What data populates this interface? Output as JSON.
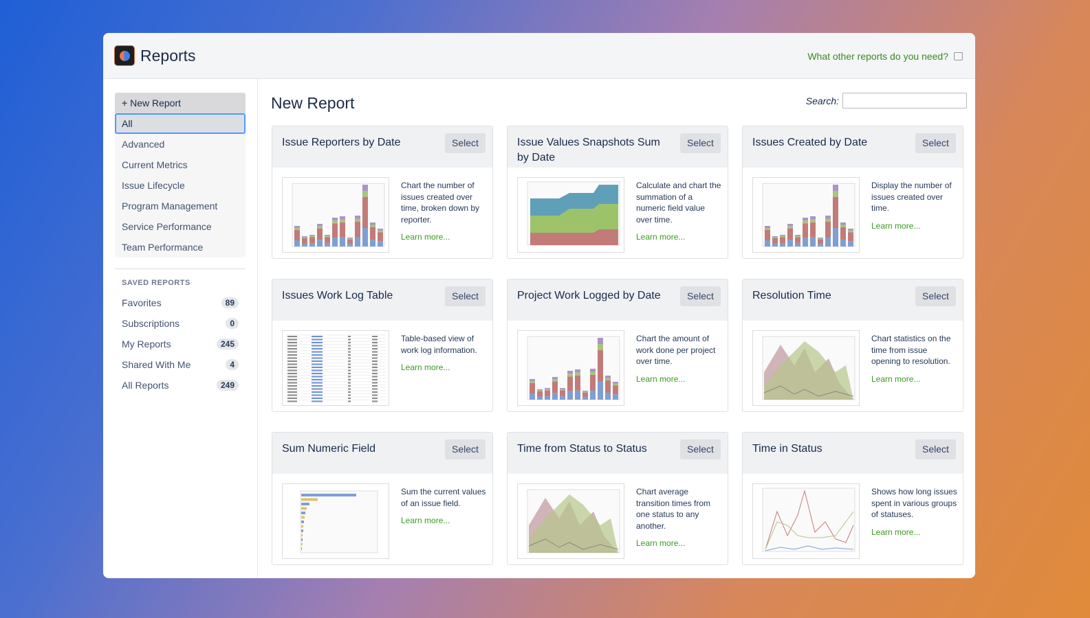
{
  "app": {
    "title": "Reports",
    "feedback": "What other reports do you need?"
  },
  "sidebar": {
    "new_report": "New Report",
    "categories": [
      "All",
      "Advanced",
      "Current Metrics",
      "Issue Lifecycle",
      "Program Management",
      "Service Performance",
      "Team Performance"
    ],
    "saved_heading": "SAVED REPORTS",
    "saved": [
      {
        "label": "Favorites",
        "count": "89"
      },
      {
        "label": "Subscriptions",
        "count": "0"
      },
      {
        "label": "My Reports",
        "count": "245"
      },
      {
        "label": "Shared With Me",
        "count": "4"
      },
      {
        "label": "All Reports",
        "count": "249"
      }
    ]
  },
  "main": {
    "title": "New Report",
    "search_label": "Search:",
    "search_value": "",
    "select_label": "Select",
    "learn_more": "Learn more...",
    "cards": [
      {
        "title": "Issue Reporters by Date",
        "desc": "Chart the number of issues created over time, broken down by reporter.",
        "thumb": "stacked-bar"
      },
      {
        "title": "Issue Values Snapshots Sum by Date",
        "desc": "Calculate and chart the summation of a numeric field value over time.",
        "thumb": "stacked-area"
      },
      {
        "title": "Issues Created by Date",
        "desc": "Display the number of issues created over time.",
        "thumb": "stacked-bar"
      },
      {
        "title": "Issues Work Log Table",
        "desc": "Table-based view of work log information.",
        "thumb": "table"
      },
      {
        "title": "Project Work Logged by Date",
        "desc": "Chart the amount of work done per project over time.",
        "thumb": "stacked-bar"
      },
      {
        "title": "Resolution Time",
        "desc": "Chart statistics on the time from issue opening to resolution.",
        "thumb": "overlap-area"
      },
      {
        "title": "Sum Numeric Field",
        "desc": "Sum the current values of an issue field.",
        "thumb": "horizontal-bar"
      },
      {
        "title": "Time from Status to Status",
        "desc": "Chart average transition times from one status to any another.",
        "thumb": "overlap-area"
      },
      {
        "title": "Time in Status",
        "desc": "Shows how long issues spent in various groups of statuses.",
        "thumb": "line"
      }
    ]
  }
}
